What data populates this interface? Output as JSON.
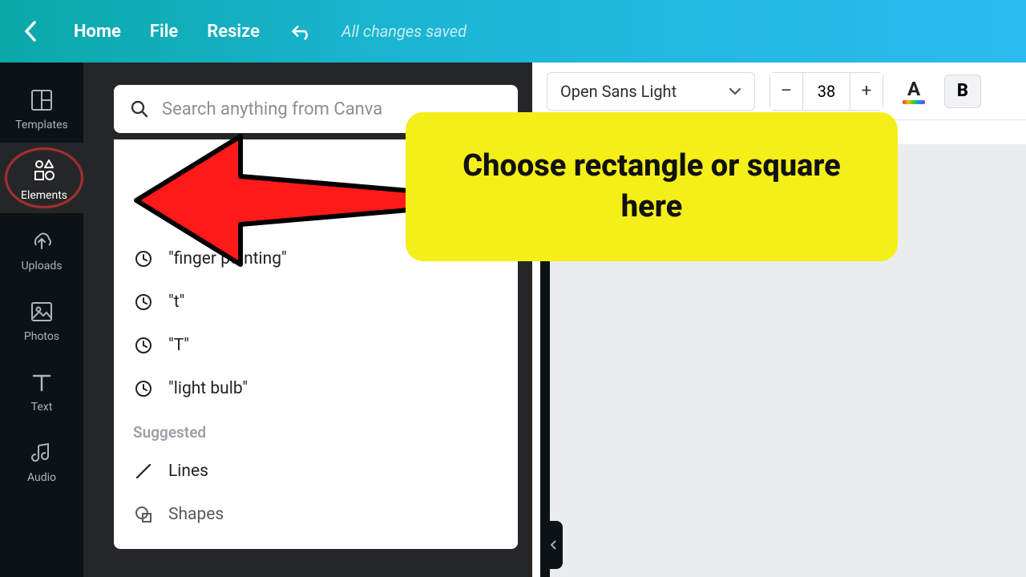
{
  "topbar": {
    "home": "Home",
    "file": "File",
    "resize": "Resize",
    "status": "All changes saved"
  },
  "sidebar": {
    "items": [
      {
        "label": "Templates"
      },
      {
        "label": "Elements"
      },
      {
        "label": "Uploads"
      },
      {
        "label": "Photos"
      },
      {
        "label": "Text"
      },
      {
        "label": "Audio"
      }
    ]
  },
  "search": {
    "placeholder": "Search anything from Canva"
  },
  "recent": [
    "\"finger pointing\"",
    "\"t\"",
    "\"T\"",
    "\"light bulb\""
  ],
  "suggested_label": "Suggested",
  "suggested": [
    "Lines",
    "Shapes"
  ],
  "toolbar": {
    "font": "Open Sans Light",
    "size": "38",
    "bold": "B"
  },
  "callout": "Choose rectangle or square here"
}
